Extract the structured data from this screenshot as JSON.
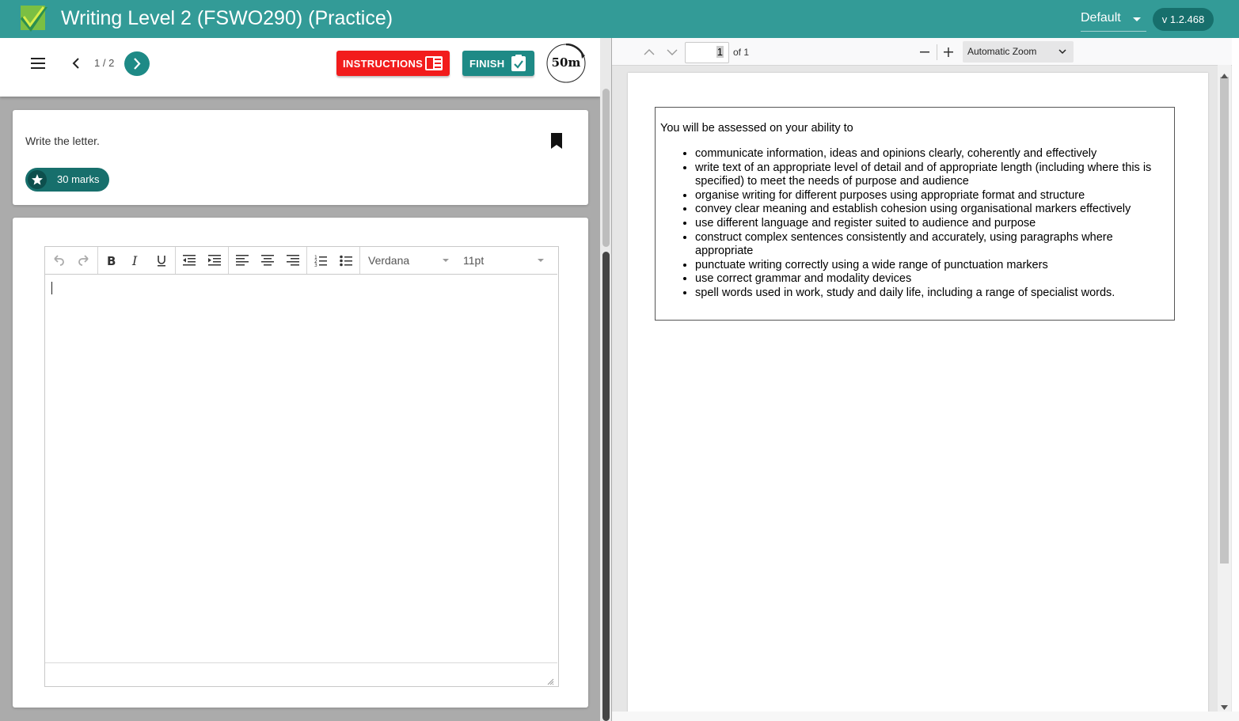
{
  "app": {
    "title": "Writing Level 2 (FSWO290) (Practice)",
    "theme_selected": "Default",
    "version": "v 1.2.468",
    "brand_color": "#339b97"
  },
  "question_bar": {
    "counter": "1 / 2",
    "instructions_label": "INSTRUCTIONS",
    "finish_label": "FINISH",
    "timer": "50m"
  },
  "question": {
    "text": "Write the letter.",
    "marks": "30 marks"
  },
  "editor": {
    "toolbar": [
      "undo-icon",
      "redo-icon",
      "bold-icon",
      "italic-icon",
      "underline-icon",
      "outdent-icon",
      "indent-icon",
      "align-left-icon",
      "align-center-icon",
      "align-right-icon",
      "numbered-list-icon",
      "bullet-list-icon"
    ],
    "font_family": "Verdana",
    "font_size": "11pt",
    "content": ""
  },
  "pdf_viewer": {
    "page_number": "1",
    "page_total": "of 1",
    "zoom": "Automatic Zoom",
    "intro": "You will be assessed on your ability to",
    "criteria": [
      "communicate information, ideas and opinions clearly, coherently and effectively",
      "write text of an appropriate level of detail and of appropriate length (including where this is specified) to meet the needs of purpose and audience",
      "organise writing for different purposes using appropriate format and structure",
      "convey clear meaning and establish cohesion using organisational markers effectively",
      "use different language and register suited to audience and purpose",
      "construct complex sentences consistently and accurately, using paragraphs where appropriate",
      "punctuate writing correctly using a wide range of punctuation markers",
      "use correct grammar and modality devices",
      "spell words used in work, study and daily life, including a range of specialist words."
    ]
  }
}
